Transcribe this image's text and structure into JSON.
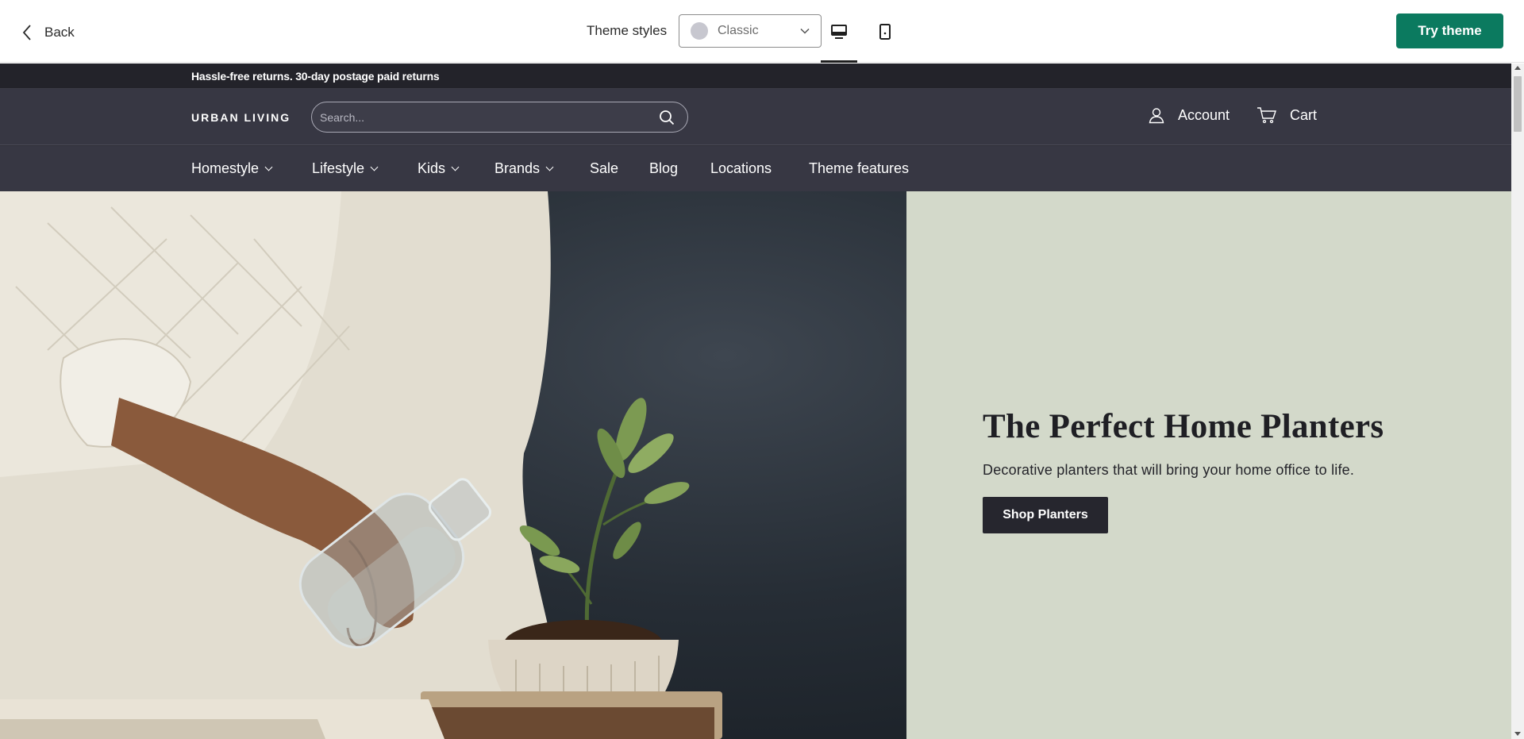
{
  "preview_bar": {
    "back_label": "Back",
    "theme_styles_label": "Theme styles",
    "style_select": {
      "value": "Classic",
      "swatch_color": "#c7c7cf"
    },
    "devices": {
      "selected": "desktop"
    },
    "try_theme_label": "Try theme",
    "try_theme_color": "#0b7a5f"
  },
  "store": {
    "announcement": "Hassle-free returns. 30-day postage paid returns",
    "logo": "URBAN LIVING",
    "search": {
      "placeholder": "Search..."
    },
    "account_label": "Account",
    "cart_label": "Cart",
    "header_color": "#373743",
    "nav": {
      "items": [
        {
          "label": "Homestyle",
          "has_dropdown": true
        },
        {
          "label": "Lifestyle",
          "has_dropdown": true
        },
        {
          "label": "Kids",
          "has_dropdown": true
        },
        {
          "label": "Brands",
          "has_dropdown": true
        },
        {
          "label": "Sale",
          "has_dropdown": false
        },
        {
          "label": "Blog",
          "has_dropdown": false
        },
        {
          "label": "Locations",
          "has_dropdown": false
        },
        {
          "label": "Theme features",
          "has_dropdown": false
        }
      ]
    }
  },
  "hero": {
    "title": "The Perfect Home Planters",
    "subtitle": "Decorative planters that will bring your home office to life.",
    "button_label": "Shop Planters",
    "panel_color": "#d3d9ca"
  }
}
